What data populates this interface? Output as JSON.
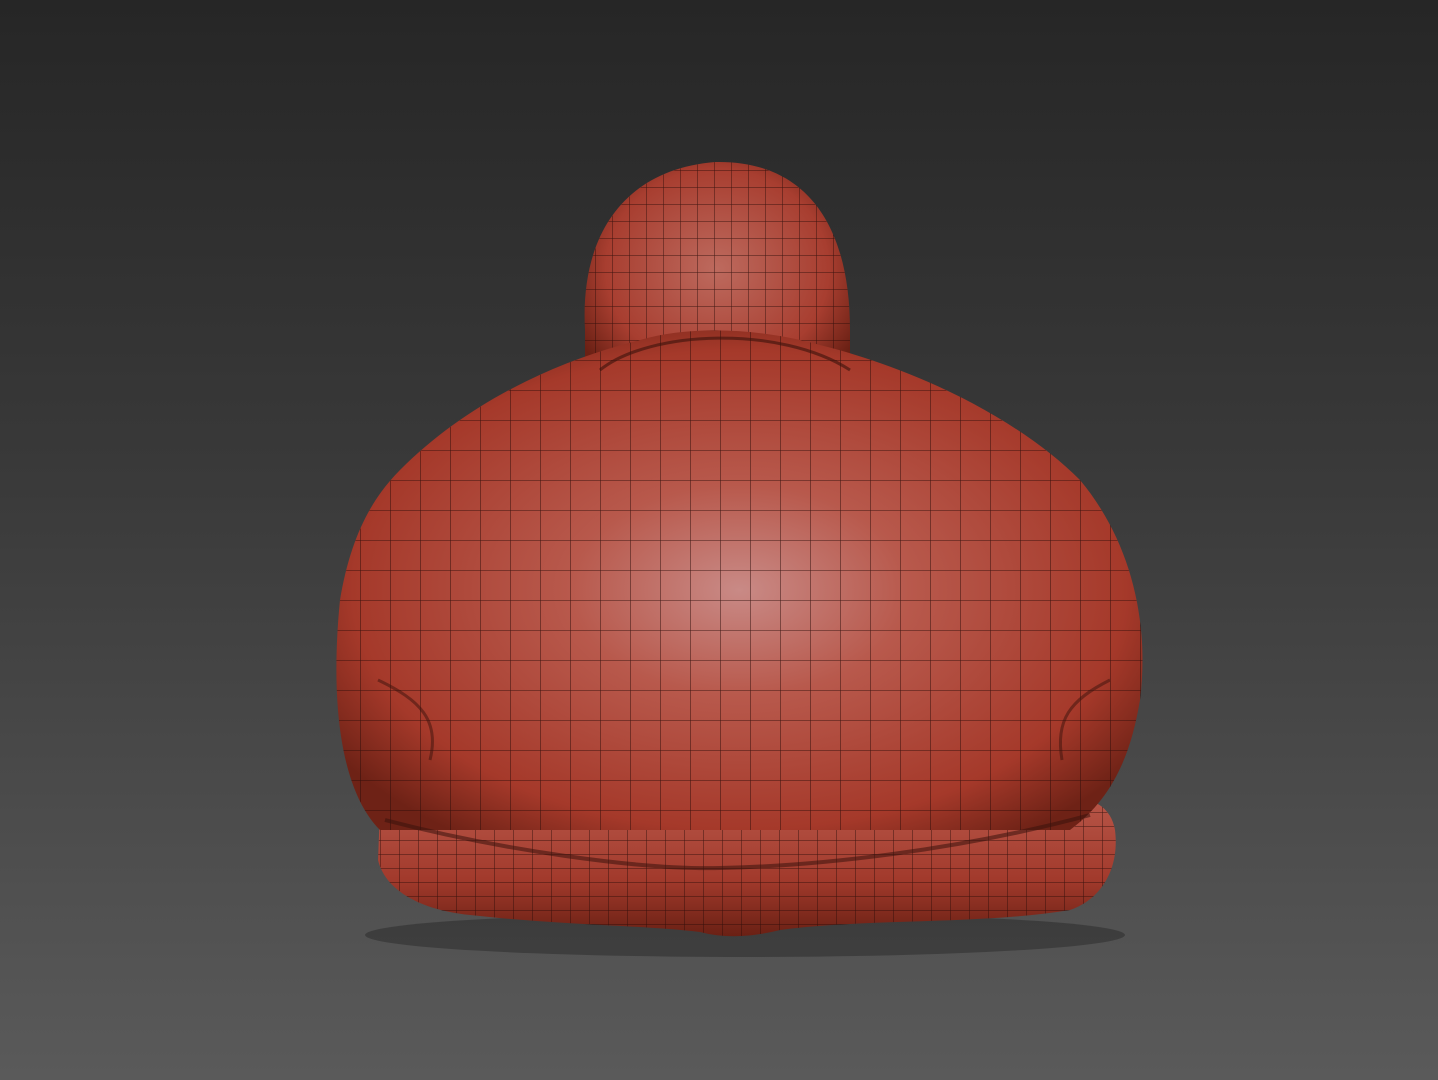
{
  "scene": {
    "background_top": "#262626",
    "background_bottom": "#5a5a5a",
    "model": {
      "subject": "wireframe-sculpt-back-view",
      "base_color": "#b84a3a",
      "highlight_color": "#c98a86",
      "shadow_color": "#5e1c14",
      "wire_color": "#2a0c08"
    }
  }
}
